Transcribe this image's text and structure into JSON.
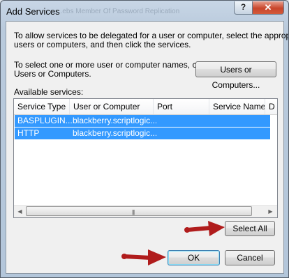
{
  "window": {
    "title": "Add Services",
    "title_background_text": "...ebs    Member Of    Password Replication"
  },
  "titlebar": {
    "help_label": "?",
    "close_label": "✕"
  },
  "intro_line1": "To allow services to be delegated for a user or computer, select the appropriate",
  "intro_line2": "users or computers, and then click the services.",
  "select_line1": "To select one or more user or computer names, click",
  "select_line2": "Users or Computers.",
  "users_button": "Users or Computers...",
  "available_label": "Available services:",
  "columns": [
    "Service Type",
    "User or Computer",
    "Port",
    "Service Name",
    "D"
  ],
  "rows": [
    {
      "service_type": "BASPLUGIN...",
      "user_or_computer": "blackberry.scriptlogic...",
      "port": "",
      "service_name": ""
    },
    {
      "service_type": "HTTP",
      "user_or_computer": "blackberry.scriptlogic...",
      "port": "",
      "service_name": ""
    }
  ],
  "scrollbar": {
    "left_arrow": "◀",
    "right_arrow": "▶",
    "grip": "|||"
  },
  "select_all_button": "Select All",
  "ok_button": "OK",
  "cancel_button": "Cancel",
  "colors": {
    "selection": "#3399ff",
    "annotation_arrow": "#b01c1c"
  }
}
